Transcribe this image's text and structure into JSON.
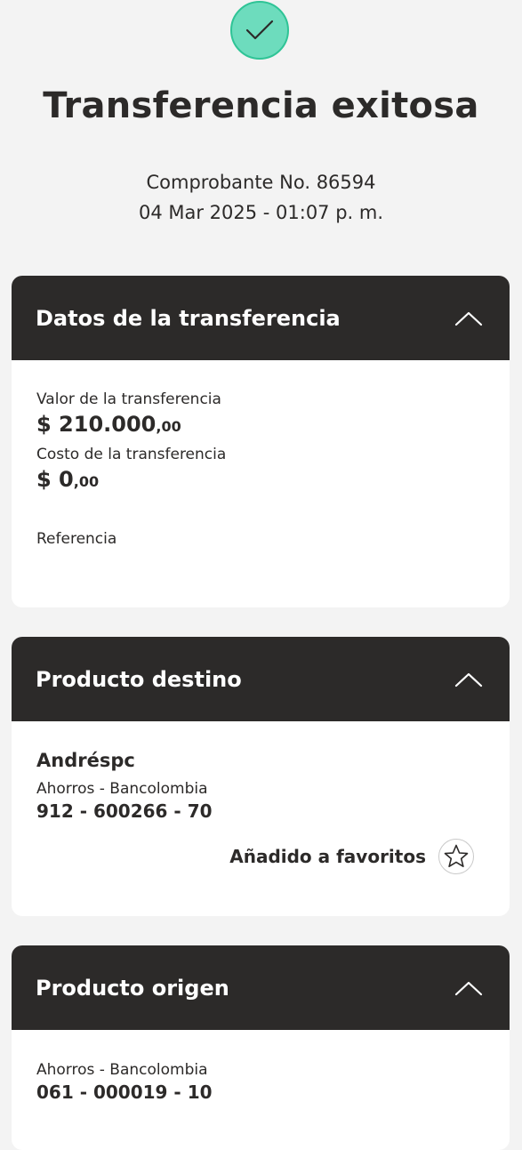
{
  "header": {
    "title": "Transferencia exitosa",
    "receipt_line": "Comprobante No. 86594",
    "date_line": "04 Mar 2025 - 01:07 p. m."
  },
  "transfer": {
    "title": "Datos de la transferencia",
    "value_label": "Valor de la transferencia",
    "value_main": "$ 210.000",
    "value_cents": ",00",
    "cost_label": "Costo de la transferencia",
    "cost_main": "$ 0",
    "cost_cents": ",00",
    "reference_label": "Referencia"
  },
  "destination": {
    "title": "Producto destino",
    "name": "Andréspc",
    "account_type": "Ahorros - Bancolombia",
    "account_number": "912 - 600266 - 70",
    "favorite_label": "Añadido a favoritos"
  },
  "origin": {
    "title": "Producto origen",
    "account_type": "Ahorros - Bancolombia",
    "account_number": "061 - 000019 - 10"
  },
  "icons": {
    "success": "check-icon",
    "collapse": "chevron-up-icon",
    "favorite": "star-icon"
  },
  "colors": {
    "success_fill": "#6ddcbd",
    "success_border": "#2fc496",
    "header_dark": "#2c2a29",
    "background": "#f3f3f3"
  }
}
